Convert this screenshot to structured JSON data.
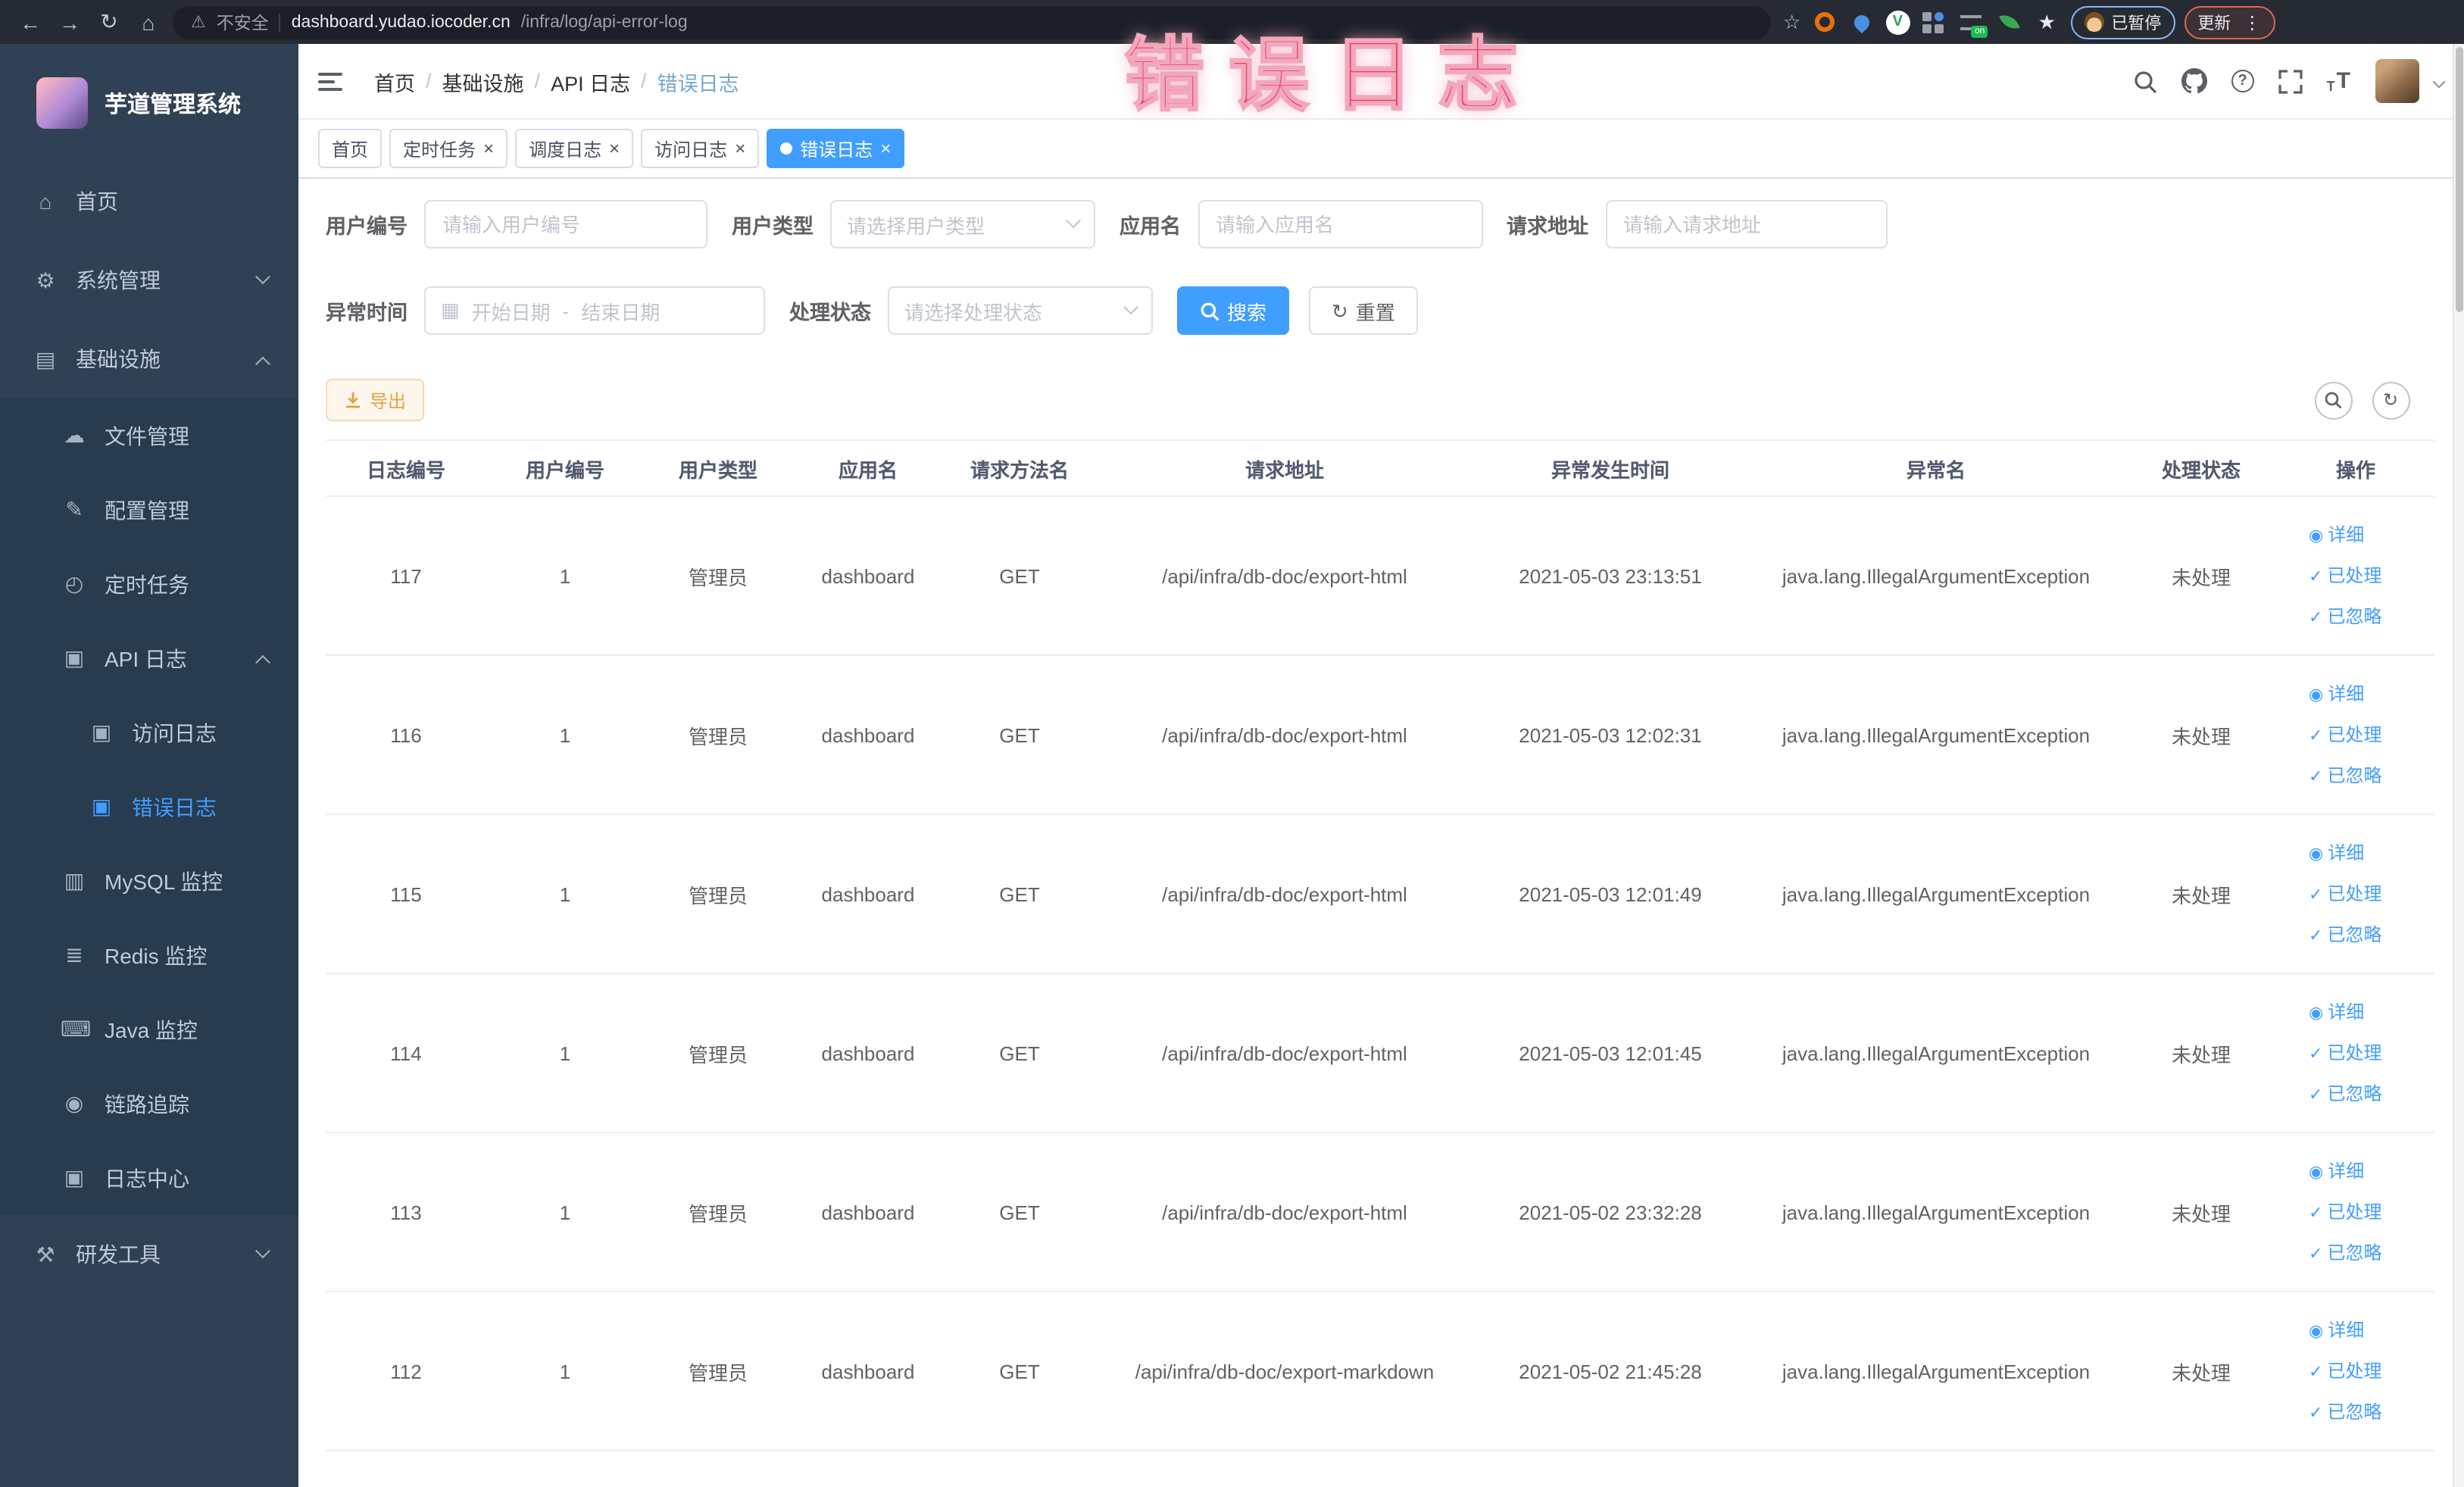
{
  "annotation": {
    "text": "错误日志"
  },
  "browser": {
    "security_label": "不安全",
    "url_domain": "dashboard.yudao.iocoder.cn",
    "url_path": "/infra/log/api-error-log",
    "paused_badge": "已暂停",
    "update_badge": "更新"
  },
  "icons": {
    "back-icon": "←",
    "forward-icon": "→",
    "reload-icon": "↻",
    "browser-home-icon": "⌂",
    "warning-icon": "⚠",
    "bookmark-star-icon": "☆",
    "extensions-star-icon": "★",
    "menu-dots-icon": "⋮",
    "home-icon": "⌂",
    "gear-icon": "⚙",
    "infra-icon": "▤",
    "cloud-upload-icon": "☁",
    "edit-icon": "✎",
    "timer-icon": "◴",
    "log-icon": "▣",
    "mysql-icon": "▥",
    "redis-icon": "≣",
    "java-icon": "⌨",
    "eye-icon": "◉",
    "tools-icon": "⚒",
    "view-icon": "◉",
    "check-icon": "✓",
    "refresh-icon": "↻",
    "calendar-icon": "▦",
    "close-icon": "×"
  },
  "sidebar": {
    "brand": "芋道管理系统",
    "items": [
      {
        "id": "home",
        "label": "首页",
        "icon": "home-icon",
        "level": 0
      },
      {
        "id": "system",
        "label": "系统管理",
        "icon": "gear-icon",
        "level": 0,
        "chevron": "down"
      },
      {
        "id": "infra",
        "label": "基础设施",
        "icon": "infra-icon",
        "level": 0,
        "chevron": "up"
      },
      {
        "id": "file",
        "label": "文件管理",
        "icon": "cloud-upload-icon",
        "level": 1,
        "group": "sub"
      },
      {
        "id": "config",
        "label": "配置管理",
        "icon": "edit-icon",
        "level": 1,
        "group": "sub"
      },
      {
        "id": "job",
        "label": "定时任务",
        "icon": "timer-icon",
        "level": 1,
        "group": "sub"
      },
      {
        "id": "api-log",
        "label": "API 日志",
        "icon": "log-icon",
        "level": 1,
        "group": "sub",
        "chevron": "up"
      },
      {
        "id": "access-log",
        "label": "访问日志",
        "icon": "log-icon",
        "level": 2,
        "group": "sub"
      },
      {
        "id": "error-log",
        "label": "错误日志",
        "icon": "log-icon",
        "level": 2,
        "group": "sub",
        "active": true
      },
      {
        "id": "mysql",
        "label": "MySQL 监控",
        "icon": "mysql-icon",
        "level": 1,
        "group": "sub"
      },
      {
        "id": "redis",
        "label": "Redis 监控",
        "icon": "redis-icon",
        "level": 1,
        "group": "sub"
      },
      {
        "id": "java",
        "label": "Java 监控",
        "icon": "java-icon",
        "level": 1,
        "group": "sub"
      },
      {
        "id": "trace",
        "label": "链路追踪",
        "icon": "eye-icon",
        "level": 1,
        "group": "sub"
      },
      {
        "id": "log-center",
        "label": "日志中心",
        "icon": "log-icon",
        "level": 1,
        "group": "sub"
      },
      {
        "id": "dev-tools",
        "label": "研发工具",
        "icon": "tools-icon",
        "level": 0,
        "chevron": "down"
      }
    ]
  },
  "header": {
    "breadcrumb": [
      "首页",
      "基础设施",
      "API 日志",
      "错误日志"
    ]
  },
  "tags_view": {
    "tabs": [
      {
        "label": "首页",
        "active": false,
        "closable": false
      },
      {
        "label": "定时任务",
        "active": false,
        "closable": true
      },
      {
        "label": "调度日志",
        "active": false,
        "closable": true
      },
      {
        "label": "访问日志",
        "active": false,
        "closable": true
      },
      {
        "label": "错误日志",
        "active": true,
        "closable": true
      }
    ]
  },
  "filters": {
    "user_id_label": "用户编号",
    "user_id_placeholder": "请输入用户编号",
    "user_type_label": "用户类型",
    "user_type_placeholder": "请选择用户类型",
    "app_name_label": "应用名",
    "app_name_placeholder": "请输入应用名",
    "request_url_label": "请求地址",
    "request_url_placeholder": "请输入请求地址",
    "exception_time_label": "异常时间",
    "start_placeholder": "开始日期",
    "range_separator": "-",
    "end_placeholder": "结束日期",
    "process_status_label": "处理状态",
    "process_status_placeholder": "请选择处理状态",
    "search_label": "搜索",
    "reset_label": "重置"
  },
  "toolbar": {
    "export_label": "导出"
  },
  "table": {
    "headers": [
      "日志编号",
      "用户编号",
      "用户类型",
      "应用名",
      "请求方法名",
      "请求地址",
      "异常发生时间",
      "异常名",
      "处理状态",
      "操作"
    ],
    "actions": [
      {
        "id": "detail",
        "label": "详细",
        "icon": "view-icon"
      },
      {
        "id": "processed",
        "label": "已处理",
        "icon": "check-icon"
      },
      {
        "id": "ignored",
        "label": "已忽略",
        "icon": "check-icon"
      }
    ],
    "rows": [
      {
        "id": "117",
        "user_id": "1",
        "user_type": "管理员",
        "app": "dashboard",
        "method": "GET",
        "url": "/api/infra/db-doc/export-html",
        "time": "2021-05-03 23:13:51",
        "exception": "java.lang.IllegalArgumentException",
        "status": "未处理"
      },
      {
        "id": "116",
        "user_id": "1",
        "user_type": "管理员",
        "app": "dashboard",
        "method": "GET",
        "url": "/api/infra/db-doc/export-html",
        "time": "2021-05-03 12:02:31",
        "exception": "java.lang.IllegalArgumentException",
        "status": "未处理"
      },
      {
        "id": "115",
        "user_id": "1",
        "user_type": "管理员",
        "app": "dashboard",
        "method": "GET",
        "url": "/api/infra/db-doc/export-html",
        "time": "2021-05-03 12:01:49",
        "exception": "java.lang.IllegalArgumentException",
        "status": "未处理"
      },
      {
        "id": "114",
        "user_id": "1",
        "user_type": "管理员",
        "app": "dashboard",
        "method": "GET",
        "url": "/api/infra/db-doc/export-html",
        "time": "2021-05-03 12:01:45",
        "exception": "java.lang.IllegalArgumentException",
        "status": "未处理"
      },
      {
        "id": "113",
        "user_id": "1",
        "user_type": "管理员",
        "app": "dashboard",
        "method": "GET",
        "url": "/api/infra/db-doc/export-html",
        "time": "2021-05-02 23:32:28",
        "exception": "java.lang.IllegalArgumentException",
        "status": "未处理"
      },
      {
        "id": "112",
        "user_id": "1",
        "user_type": "管理员",
        "app": "dashboard",
        "method": "GET",
        "url": "/api/infra/db-doc/export-markdown",
        "time": "2021-05-02 21:45:28",
        "exception": "java.lang.IllegalArgumentException",
        "status": "未处理"
      }
    ]
  },
  "colors": {
    "accent": "#409eff",
    "warning": "#e6a23c",
    "sidebar_bg": "#304156",
    "sidebar_sub_bg": "#283b4f",
    "annotation_pink": "#e6496a",
    "tag_active_bg": "#409eff"
  }
}
